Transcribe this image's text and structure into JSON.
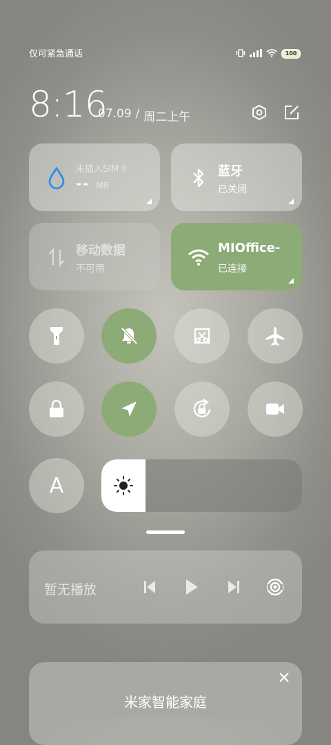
{
  "status_bar": {
    "carrier_text": "仅可紧急通话",
    "battery": "100"
  },
  "header": {
    "time": "8:16",
    "date": "07.09",
    "separator": "/",
    "weekday": "周二上午"
  },
  "tiles": {
    "data_usage": {
      "title": "未插入SIM卡",
      "value": "--",
      "unit": "MB"
    },
    "bluetooth": {
      "title": "蓝牙",
      "status": "已关闭"
    },
    "mobile_data": {
      "title": "移动数据",
      "status": "不可用"
    },
    "wifi": {
      "title": "MIOffice-",
      "status": "已连接"
    }
  },
  "toggles": [
    {
      "name": "flashlight",
      "active": false
    },
    {
      "name": "mute",
      "active": true
    },
    {
      "name": "screenshot",
      "active": false
    },
    {
      "name": "airplane-mode",
      "active": false
    },
    {
      "name": "lock-screen",
      "active": false
    },
    {
      "name": "location",
      "active": true
    },
    {
      "name": "auto-rotate-lock",
      "active": false
    },
    {
      "name": "screen-recorder",
      "active": false
    }
  ],
  "brightness": {
    "auto_label": "A",
    "level": 0.22
  },
  "media": {
    "label": "暂无播放"
  },
  "smart_home": {
    "title": "米家智能家庭"
  },
  "colors": {
    "active_green": "#8dab77",
    "battery_fill": "#e9efcf"
  }
}
